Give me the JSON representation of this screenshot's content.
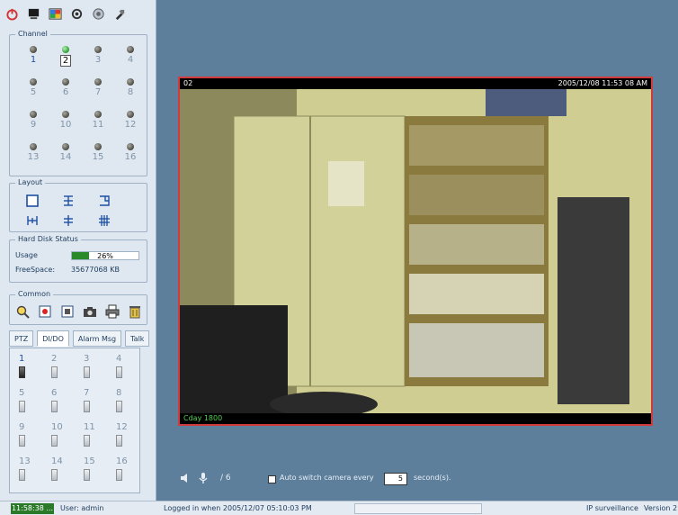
{
  "toolbar": {
    "icons": [
      "power-icon",
      "monitor-icon",
      "image-icon",
      "settings-icon",
      "network-icon",
      "tools-icon"
    ]
  },
  "channel": {
    "label": "Channel",
    "items": [
      {
        "num": "1",
        "led": "off",
        "active": true
      },
      {
        "num": "2",
        "led": "on",
        "active": true,
        "selected": true
      },
      {
        "num": "3",
        "led": "off",
        "active": false
      },
      {
        "num": "4",
        "led": "off",
        "active": false
      },
      {
        "num": "5",
        "led": "off",
        "active": false
      },
      {
        "num": "6",
        "led": "off",
        "active": false
      },
      {
        "num": "7",
        "led": "off",
        "active": false
      },
      {
        "num": "8",
        "led": "off",
        "active": false
      },
      {
        "num": "9",
        "led": "off",
        "active": false
      },
      {
        "num": "10",
        "led": "off",
        "active": false
      },
      {
        "num": "11",
        "led": "off",
        "active": false
      },
      {
        "num": "12",
        "led": "off",
        "active": false
      },
      {
        "num": "13",
        "led": "off",
        "active": false
      },
      {
        "num": "14",
        "led": "off",
        "active": false
      },
      {
        "num": "15",
        "led": "off",
        "active": false
      },
      {
        "num": "16",
        "led": "off",
        "active": false
      }
    ]
  },
  "layout": {
    "label": "Layout",
    "icons": [
      "layout-1x1-icon",
      "layout-split-icon",
      "layout-corner-icon",
      "layout-h-icon",
      "layout-cross-icon",
      "layout-grid-icon"
    ]
  },
  "hdd": {
    "label": "Hard Disk Status",
    "usage_label": "Usage",
    "usage_value": "26%",
    "usage_fraction": 0.26,
    "free_label": "FreeSpace:",
    "free_value": "35677068 KB"
  },
  "common": {
    "label": "Common",
    "icons": [
      "search-icon",
      "record-icon",
      "stop-icon",
      "camera-icon",
      "print-icon",
      "trash-icon"
    ]
  },
  "tabs": [
    "PTZ",
    "DI/DO",
    "Alarm Msg",
    "Talk"
  ],
  "dido": [
    "1",
    "2",
    "3",
    "4",
    "5",
    "6",
    "7",
    "8",
    "9",
    "10",
    "11",
    "12",
    "13",
    "14",
    "15",
    "16"
  ],
  "video": {
    "camera": "02",
    "timestamp": "2005/12/08 11:53 08 AM",
    "overlay": "Cday 1800"
  },
  "controls": {
    "page": "/ 6",
    "autoswitch_label": "Auto switch camera every",
    "autoswitch_seconds": "5",
    "seconds_label": "second(s)."
  },
  "status": {
    "time": "11:58:38 ...",
    "user": "User: admin",
    "logged": "Logged in when 2005/12/07 05:10:03 PM",
    "product": "IP surveillance",
    "version": "Version 2"
  },
  "colors": {
    "accent_green": "#2a8a2a",
    "video_border": "#d23b3b",
    "background": "#5d7f9c"
  }
}
